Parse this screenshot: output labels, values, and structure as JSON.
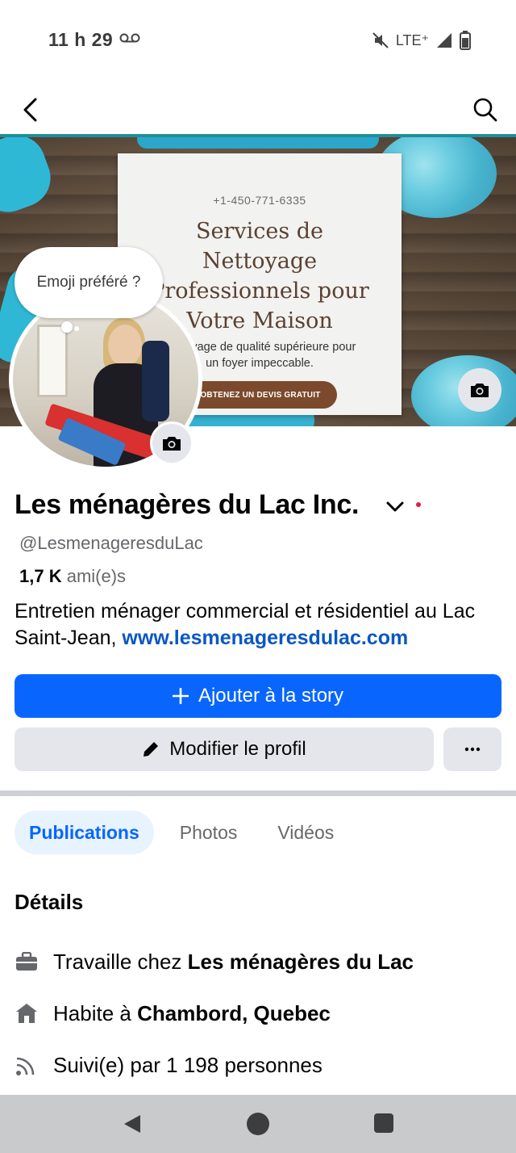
{
  "status_bar": {
    "time": "11 h 29",
    "network": "LTE⁺",
    "icons": [
      "voicemail-icon",
      "mute-icon",
      "signal-icon",
      "battery-icon"
    ]
  },
  "top_nav": {
    "back_icon": "chevron-left-icon",
    "search_icon": "search-icon"
  },
  "cover": {
    "flyer_phone": "+1-450-771-6335",
    "flyer_title_lines": [
      "Services de",
      "Nettoyage",
      "Professionnels pour",
      "Votre Maison"
    ],
    "flyer_sub_lines": [
      "Nettoyage de qualité supérieure pour",
      "un foyer impeccable."
    ],
    "flyer_cta": "OBTENEZ UN DEVIS GRATUIT",
    "camera_icon": "camera-icon"
  },
  "emoji_prompt": "Emoji préféré ?",
  "profile": {
    "name": "Les ménagères du Lac Inc.",
    "handle": "@LesmenageresduLac",
    "friends_count": "1,7 K",
    "friends_label": "ami(e)s",
    "bio_text": "Entretien ménager commercial et résidentiel au Lac Saint-Jean,",
    "bio_link": "www.lesmenageresdulac.com",
    "verified_dot_color": "#e41e3f"
  },
  "actions": {
    "add_story": "Ajouter à la story",
    "edit_profile": "Modifier le profil",
    "more": "···"
  },
  "tabs": [
    {
      "label": "Publications",
      "active": true
    },
    {
      "label": "Photos",
      "active": false
    },
    {
      "label": "Vidéos",
      "active": false
    }
  ],
  "details": {
    "title": "Détails",
    "work_prefix": "Travaille chez",
    "work_place": "Les ménagères du Lac",
    "home_prefix": "Habite à",
    "home_place": "Chambord, Quebec",
    "followers": "Suivi(e) par 1 198 personnes"
  },
  "colors": {
    "accent": "#0866ff",
    "link": "#0a57c2",
    "secondary_button": "#e4e6eb",
    "tab_active_bg": "#e7f3ff"
  }
}
